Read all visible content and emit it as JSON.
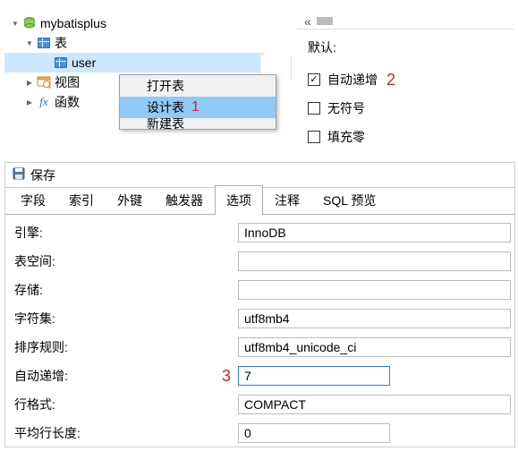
{
  "tree": {
    "db": "mybatisplus",
    "tables_label": "表",
    "table_item": "user",
    "views_label": "视图",
    "functions_label": "函数"
  },
  "ctx": {
    "open": "打开表",
    "design": "设计表",
    "new": "新建表",
    "num1": "1"
  },
  "right_panel": {
    "default_label": "默认:",
    "auto_inc": "自动递增",
    "unsigned": "无符号",
    "zerofill": "填充零",
    "num2": "2"
  },
  "props": {
    "save": "保存",
    "tabs": {
      "fields": "字段",
      "index": "索引",
      "fk": "外键",
      "trigger": "触发器",
      "options": "选项",
      "comment": "注释",
      "sqlpreview": "SQL 预览"
    },
    "rows": {
      "engine_l": "引擎:",
      "engine_v": "InnoDB",
      "tablespace_l": "表空间:",
      "tablespace_v": "",
      "storage_l": "存储:",
      "storage_v": "",
      "charset_l": "字符集:",
      "charset_v": "utf8mb4",
      "collation_l": "排序规则:",
      "collation_v": "utf8mb4_unicode_ci",
      "autoinc_l": "自动递增:",
      "autoinc_v": "7",
      "rowfmt_l": "行格式:",
      "rowfmt_v": "COMPACT",
      "avgrow_l": "平均行长度:",
      "avgrow_v": "0",
      "num3": "3"
    }
  }
}
